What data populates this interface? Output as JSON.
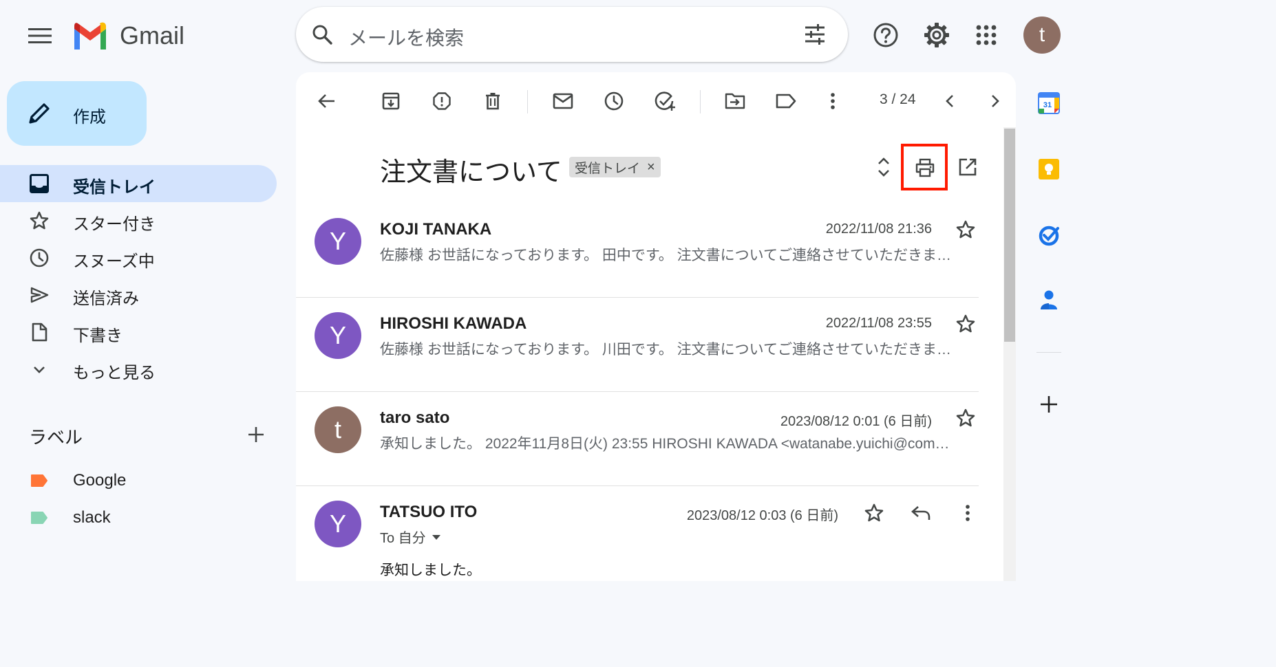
{
  "app": {
    "name": "Gmail"
  },
  "colors": {
    "accent_blue": "#c2e7ff",
    "active_nav": "#d3e3fd",
    "highlight": "#ff1a00",
    "avatar_purple": "#7e57c2",
    "avatar_brown": "#8d6e63",
    "label_google": "#ff7537",
    "label_slack": "#89d5b4"
  },
  "header": {
    "menu_icon": "hamburger-icon",
    "search_placeholder": "メールを検索",
    "avatar_letter": "t"
  },
  "sidebar": {
    "compose_label": "作成",
    "items": [
      {
        "label": "受信トレイ",
        "icon": "inbox-icon",
        "active": true
      },
      {
        "label": "スター付き",
        "icon": "star-icon"
      },
      {
        "label": "スヌーズ中",
        "icon": "clock-icon"
      },
      {
        "label": "送信済み",
        "icon": "send-icon"
      },
      {
        "label": "下書き",
        "icon": "draft-icon"
      },
      {
        "label": "もっと見る",
        "icon": "chevron-down-icon"
      }
    ],
    "labels_title": "ラベル",
    "labels": [
      {
        "name": "Google"
      },
      {
        "name": "slack"
      }
    ]
  },
  "toolbar": {
    "pager": "3 / 24"
  },
  "thread": {
    "subject": "注文書について",
    "chip_label": "受信トレイ",
    "chip_close": "×",
    "messages": [
      {
        "avatar": "Y",
        "sender": "KOJI TANAKA",
        "date": "2022/11/08 21:36",
        "snippet": "佐藤様 お世話になっております。 田中です。 注文書についてご連絡させていただきま…"
      },
      {
        "avatar": "Y",
        "sender": "HIROSHI KAWADA",
        "date": "2022/11/08 23:55",
        "snippet": "佐藤様 お世話になっております。 川田です。 注文書についてご連絡させていただきま…"
      },
      {
        "avatar": "t",
        "sender": "taro sato",
        "date": "2023/08/12 0:01 (6 日前)",
        "snippet": "承知しました。 2022年11月8日(火) 23:55 HIROSHI KAWADA <watanabe.yuichi@com…"
      },
      {
        "avatar": "Y",
        "sender": "TATSUO ITO",
        "date": "2023/08/12 0:03 (6 日前)",
        "to": "To 自分",
        "body": "承知しました。"
      }
    ]
  }
}
